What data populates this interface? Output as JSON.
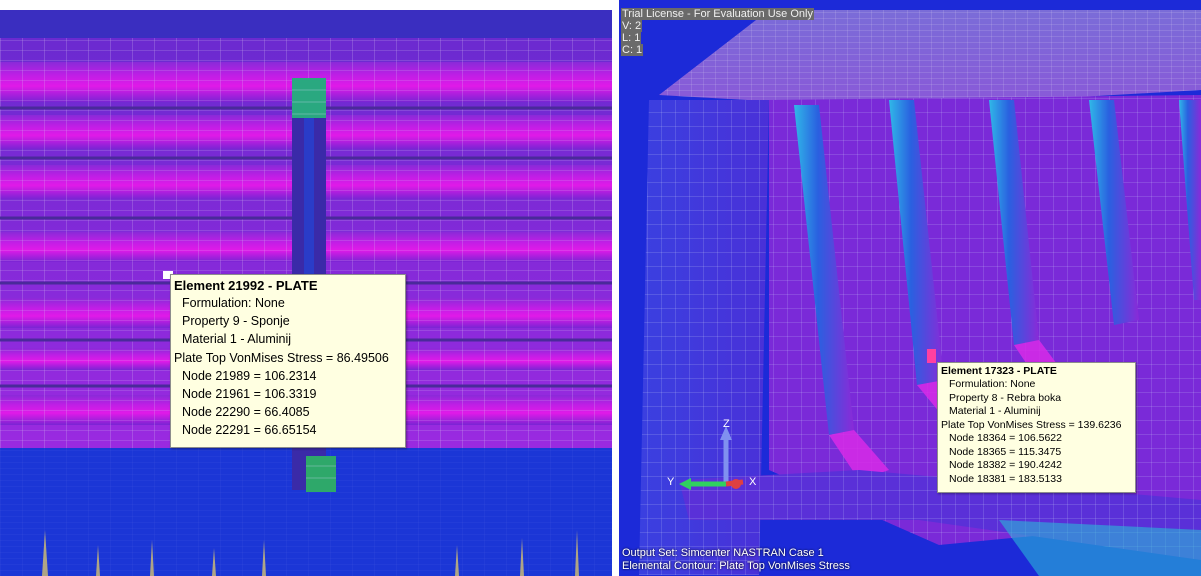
{
  "left_view": {
    "tooltip": {
      "title": "Element 21992 - PLATE",
      "lines": [
        "Formulation: None",
        "Property 9 - Sponje",
        "Material 1 - Aluminij",
        "Plate Top VonMises Stress = 86.49506",
        "Node 21989 = 106.2314",
        "Node 21961 = 106.3319",
        "Node 22290 = 66.4085",
        "Node 22291 = 66.65154"
      ]
    }
  },
  "right_view": {
    "license": {
      "title": "Trial License - For Evaluation Use Only",
      "v": "V: 2",
      "l": "L: 1",
      "c": "C: 1"
    },
    "tooltip": {
      "title": "Element 17323 - PLATE",
      "lines": [
        "Formulation: None",
        "Property 8 - Rebra boka",
        "Material 1 - Aluminij",
        "Plate Top VonMises Stress = 139.6236",
        "Node 18364 = 106.5622",
        "Node 18365 = 115.3475",
        "Node 18382 = 190.4242",
        "Node 18381 = 183.5133"
      ]
    },
    "axes": {
      "x": "X",
      "y": "Y",
      "z": "Z"
    },
    "status": {
      "output_set": "Output Set: Simcenter NASTRAN Case 1",
      "contour": "Elemental Contour: Plate Top VonMises Stress"
    }
  },
  "colors": {
    "background_blue": "#1a2fd8",
    "stress_purple": "#8a1fd8",
    "stress_magenta": "#d818e8",
    "stress_cyan": "#30c8e8",
    "stress_green": "#2ec070",
    "tooltip_bg": "#ffffe1"
  }
}
